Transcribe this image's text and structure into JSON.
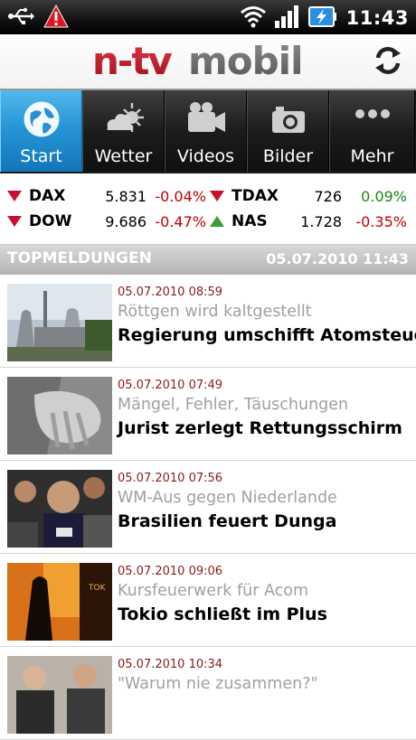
{
  "status_bar": {
    "time": "11:43",
    "left_icons": [
      "usb-icon",
      "warning-icon"
    ],
    "right_icons": [
      "wifi-icon",
      "signal-icon",
      "battery-charging-icon"
    ]
  },
  "header": {
    "logo_text": "n-tv mobil",
    "refresh_icon": "refresh-icon",
    "colors": {
      "logo_red": "#c8102e",
      "logo_grey": "#6e6e6e"
    }
  },
  "tabs": [
    {
      "label": "Start",
      "icon": "globe-icon",
      "active": true
    },
    {
      "label": "Wetter",
      "icon": "weather-icon",
      "active": false
    },
    {
      "label": "Videos",
      "icon": "video-camera-icon",
      "active": false
    },
    {
      "label": "Bilder",
      "icon": "photo-camera-icon",
      "active": false
    },
    {
      "label": "Mehr",
      "icon": "more-icon",
      "active": false
    }
  ],
  "ticker": [
    {
      "name": "DAX",
      "value": "5.831",
      "change": "-0.04%",
      "direction": "down"
    },
    {
      "name": "TDAX",
      "value": "726",
      "change": "0.09%",
      "direction": "down"
    },
    {
      "name": "DOW",
      "value": "9.686",
      "change": "-0.47%",
      "direction": "down"
    },
    {
      "name": "NAS",
      "value": "1.728",
      "change": "-0.35%",
      "direction": "up"
    }
  ],
  "section": {
    "title": "TOPMELDUNGEN",
    "date": "05.07.2010 11:43"
  },
  "news": [
    {
      "timestamp": "05.07.2010 08:59",
      "kicker": "Röttgen wird kaltgestellt",
      "headline": "Regierung umschifft Atomsteuer",
      "thumb": "power-plant"
    },
    {
      "timestamp": "05.07.2010 07:49",
      "kicker": "Mängel, Fehler, Täuschungen",
      "headline": "Jurist zerlegt Rettungsschirm",
      "thumb": "hands"
    },
    {
      "timestamp": "05.07.2010 07:56",
      "kicker": "WM-Aus gegen Niederlande",
      "headline": "Brasilien feuert Dunga",
      "thumb": "press-crowd"
    },
    {
      "timestamp": "05.07.2010 09:06",
      "kicker": "Kursfeuerwerk für Acom",
      "headline": "Tokio schließt im Plus",
      "thumb": "stock-board"
    },
    {
      "timestamp": "05.07.2010 10:34",
      "kicker": "\"Warum nie zusammen?\"",
      "headline": "",
      "thumb": "politicians"
    }
  ],
  "colors": {
    "active_tab": "#2596d6",
    "negative": "#c40000",
    "positive": "#168a16",
    "timestamp": "#8b1a1a",
    "kicker": "#a0a0a0"
  }
}
